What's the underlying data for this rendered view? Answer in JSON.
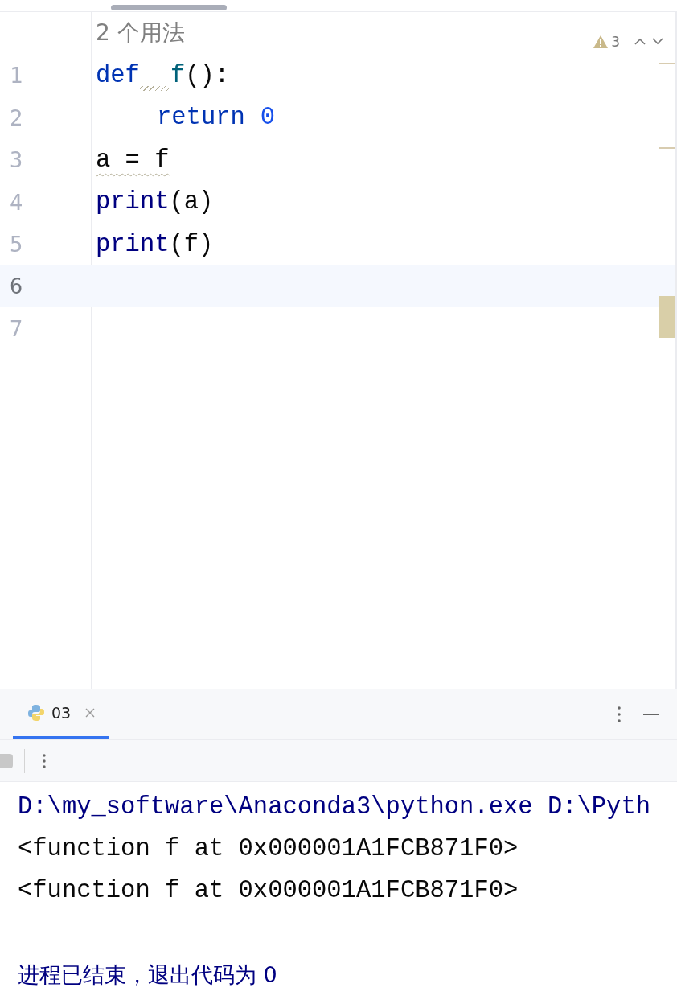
{
  "editor": {
    "usages_hint": "2 个用法",
    "warnings": {
      "count": "3"
    },
    "lines": [
      {
        "number": "1",
        "current": false,
        "indented": false,
        "tokens": [
          {
            "text": "def",
            "kind": "keyword",
            "warn": false,
            "squiggle_before": false
          },
          {
            "text": "f",
            "kind": "func",
            "warn": false,
            "squiggle_before": true
          },
          {
            "text": "():",
            "kind": "plain",
            "warn": false,
            "squiggle_before": false
          }
        ]
      },
      {
        "number": "2",
        "current": false,
        "indented": true,
        "tokens": [
          {
            "text": "return",
            "kind": "keyword",
            "warn": false,
            "squiggle_before": false
          },
          {
            "text": "0",
            "kind": "number",
            "warn": false,
            "squiggle_before": false,
            "space_before": true
          }
        ]
      },
      {
        "number": "3",
        "current": false,
        "indented": false,
        "tokens": [
          {
            "text": "a = f",
            "kind": "plain",
            "warn": true
          }
        ]
      },
      {
        "number": "4",
        "current": false,
        "indented": false,
        "tokens": [
          {
            "text": "print",
            "kind": "builtin",
            "warn": false
          },
          {
            "text": "(a)",
            "kind": "plain",
            "warn": false
          }
        ]
      },
      {
        "number": "5",
        "current": false,
        "indented": false,
        "tokens": [
          {
            "text": "print",
            "kind": "builtin",
            "warn": false
          },
          {
            "text": "(f)",
            "kind": "plain",
            "warn": false
          }
        ]
      },
      {
        "number": "6",
        "current": true,
        "indented": false
      },
      {
        "number": "7",
        "current": false,
        "indented": false
      }
    ]
  },
  "run_panel": {
    "tabs": [
      {
        "label": "03",
        "selected": true
      }
    ],
    "console": [
      {
        "text": "D:\\my_software\\Anaconda3\\python.exe D:\\Pyth",
        "kind": "command"
      },
      {
        "text": "<function f at 0x000001A1FCB871F0>",
        "kind": "output"
      },
      {
        "text": "<function f at 0x000001A1FCB871F0>",
        "kind": "output"
      },
      {
        "text": "进程已结束，退出代码为 0",
        "kind": "status"
      }
    ]
  }
}
